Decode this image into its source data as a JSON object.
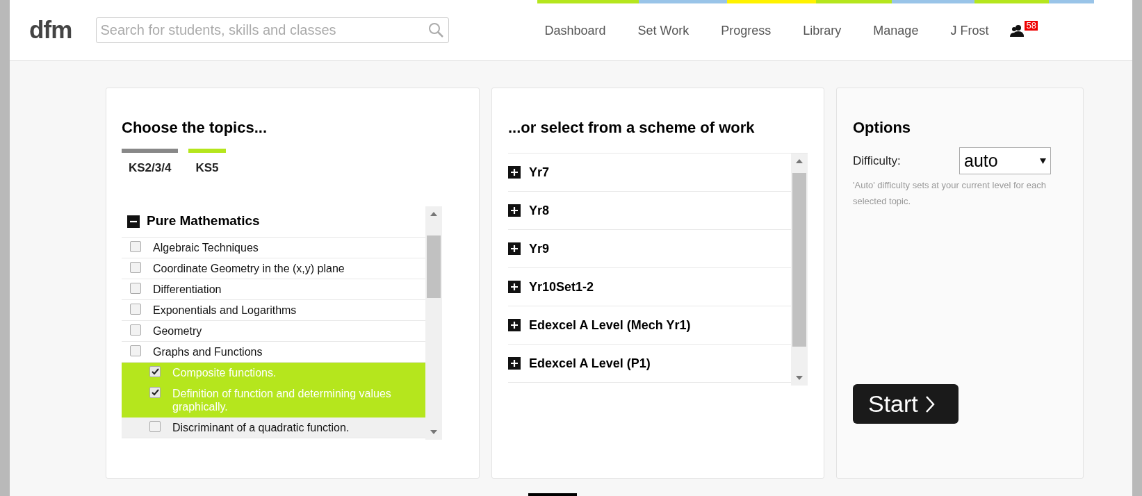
{
  "header": {
    "logo": "dfm",
    "search": {
      "placeholder": "Search for students, skills and classes"
    },
    "nav": [
      "Dashboard",
      "Set Work",
      "Progress",
      "Library",
      "Manage",
      "J Frost"
    ],
    "notification_count": "58"
  },
  "topics": {
    "title": "Choose the topics...",
    "tabs": [
      {
        "label": "KS2/3/4",
        "selected": false
      },
      {
        "label": "KS5",
        "selected": true
      }
    ],
    "tree": [
      {
        "label": "Pure Mathematics",
        "expanded": true,
        "children": [
          {
            "label": "Algebraic Techniques",
            "checked": false
          },
          {
            "label": "Coordinate Geometry in the (x,y) plane",
            "checked": false
          },
          {
            "label": "Differentiation",
            "checked": false
          },
          {
            "label": "Exponentials and Logarithms",
            "checked": false
          },
          {
            "label": "Geometry",
            "checked": false
          },
          {
            "label": "Graphs and Functions",
            "checked": false,
            "children": [
              {
                "label": "Composite functions.",
                "checked": true
              },
              {
                "label": "Definition of function and determining values graphically.",
                "checked": true
              },
              {
                "label": "Discriminant of a quadratic function.",
                "checked": false
              }
            ]
          }
        ]
      }
    ]
  },
  "schemes": {
    "title": "...or select from a scheme of work",
    "items": [
      {
        "label": "Yr7",
        "expanded": false
      },
      {
        "label": "Yr8",
        "expanded": false
      },
      {
        "label": "Yr9",
        "expanded": false
      },
      {
        "label": "Yr10Set1-2",
        "expanded": false
      },
      {
        "label": "Edexcel A Level (Mech Yr1)",
        "expanded": false
      },
      {
        "label": "Edexcel A Level (P1)",
        "expanded": false
      }
    ]
  },
  "options": {
    "title": "Options",
    "difficulty_label": "Difficulty:",
    "difficulty_value": "auto",
    "hint": "'Auto' difficulty sets at your current level for each selected topic.",
    "start_button": "Start"
  }
}
